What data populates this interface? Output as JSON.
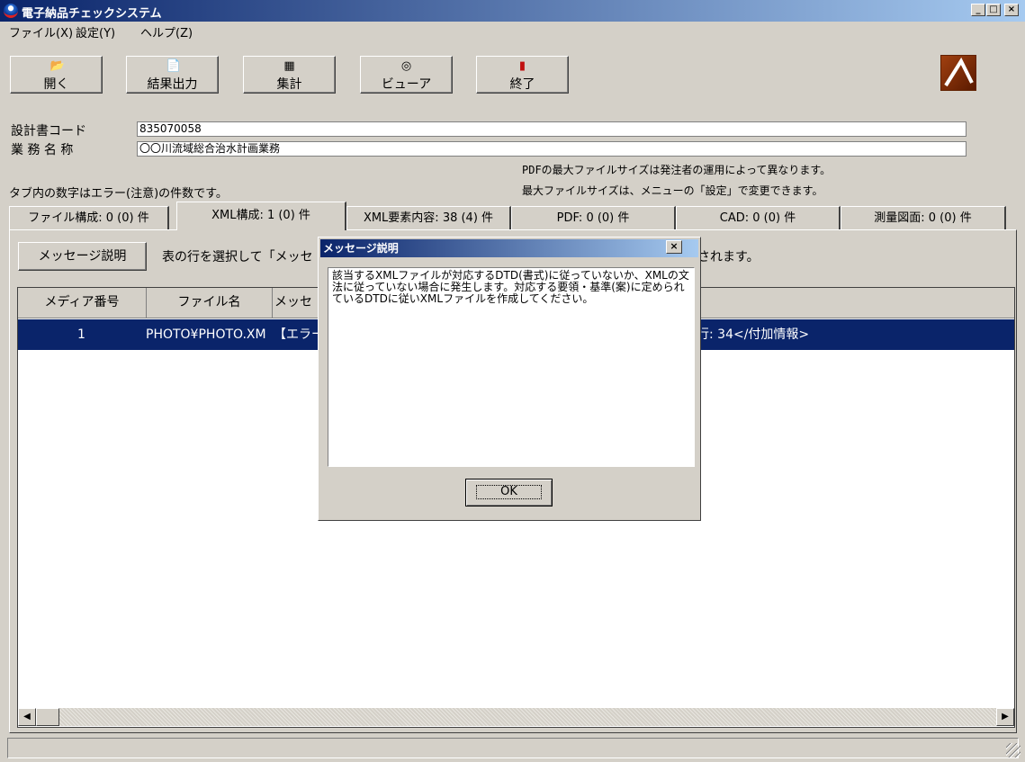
{
  "window": {
    "title": "電子納品チェックシステム",
    "min": "_",
    "max": "□",
    "close": "×"
  },
  "menu": [
    "ファイル(X)",
    "設定(Y)",
    "ヘルプ(Z)"
  ],
  "toolbar": [
    {
      "label": "開く",
      "icon": "open-folder-icon",
      "glyph": "📂"
    },
    {
      "label": "結果出力",
      "icon": "output-document-icon",
      "glyph": "📄"
    },
    {
      "label": "集計",
      "icon": "calculator-icon",
      "glyph": "▦"
    },
    {
      "label": "ビューア",
      "icon": "cd-disc-icon",
      "glyph": "◎"
    },
    {
      "label": "終了",
      "icon": "exit-door-icon",
      "glyph": "▮"
    }
  ],
  "fields": {
    "code_label": "設計書コード",
    "code_value": "835070058",
    "name_label": "業 務 名 称",
    "name_value": "〇〇川流域総合治水計画業務"
  },
  "notes": {
    "pdf_line1": "PDFの最大ファイルサイズは発注者の運用によって異なります。",
    "pdf_line2": "最大ファイルサイズは、メニューの「設定」で変更できます。",
    "tab_hint": "タブ内の数字はエラー(注意)の件数です。"
  },
  "tabs": [
    {
      "label": "ファイル構成: 0 (0) 件",
      "active": false
    },
    {
      "label": "XML構成: 1 (0) 件",
      "active": true
    },
    {
      "label": "XML要素内容: 38 (4) 件",
      "active": false
    },
    {
      "label": "PDF: 0 (0) 件",
      "active": false
    },
    {
      "label": "CAD: 0 (0) 件",
      "active": false
    },
    {
      "label": "測量図面: 0 (0) 件",
      "active": false
    }
  ],
  "panel": {
    "msg_button": "メッセージ説明",
    "instruction_left": "表の行を選択して「メッセ",
    "instruction_right": "されます。"
  },
  "grid": {
    "headers": [
      "メディア番号",
      "ファイル名",
      "メッセ"
    ],
    "row": {
      "media": "1",
      "file": "PHOTO¥PHOTO.XM",
      "msg": "【エラー",
      "tail": "行: 34</付加情報>"
    }
  },
  "scroll": {
    "left": "◀",
    "right": "▶"
  },
  "dialog": {
    "title": "メッセージ説明",
    "close": "×",
    "text": "該当するXMLファイルが対応するDTD(書式)に従っていないか、XMLの文法に従っていない場合に発生します。対応する要領・基準(案)に定められているDTDに従いXMLファイルを作成してください。",
    "ok": "OK"
  }
}
